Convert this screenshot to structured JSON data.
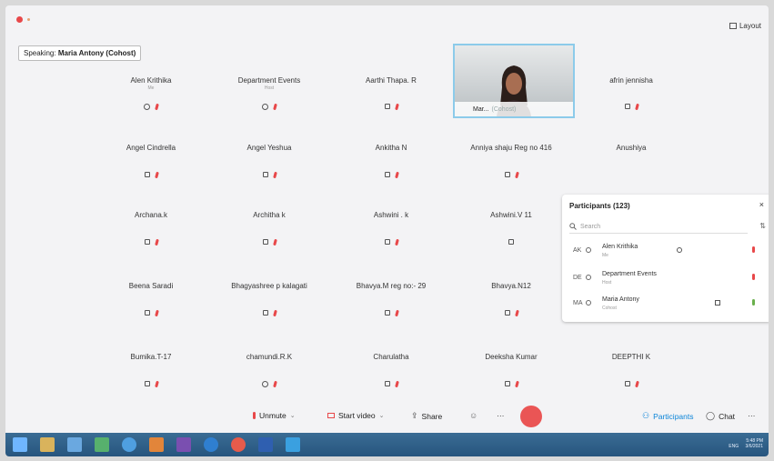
{
  "topbar": {
    "layout_label": "Layout"
  },
  "speaking": {
    "prefix": "Speaking:",
    "name": "Maria Antony (Cohost)"
  },
  "tiles": [
    {
      "name": "Alen Krithika",
      "sub": "Me"
    },
    {
      "name": "Department Events",
      "sub": "Host"
    },
    {
      "name": "Aarthi Thapa. R",
      "sub": ""
    },
    {
      "name": "afrin jennisha",
      "sub": ""
    },
    {
      "name": "Angel Cindrella",
      "sub": ""
    },
    {
      "name": "Angel Yeshua",
      "sub": ""
    },
    {
      "name": "Ankitha N",
      "sub": ""
    },
    {
      "name": "Anniya shaju Reg no 416",
      "sub": ""
    },
    {
      "name": "Anushiya",
      "sub": ""
    },
    {
      "name": "Archana.k",
      "sub": ""
    },
    {
      "name": "Architha k",
      "sub": ""
    },
    {
      "name": "Ashwini . k",
      "sub": ""
    },
    {
      "name": "Ashwini.V 11",
      "sub": ""
    },
    {
      "name": "Beena Saradi",
      "sub": ""
    },
    {
      "name": "Bhagyashree p kalagati",
      "sub": ""
    },
    {
      "name": "Bhavya.M reg no:- 29",
      "sub": ""
    },
    {
      "name": "Bhavya.N12",
      "sub": ""
    },
    {
      "name": "Bumika.T-17",
      "sub": ""
    },
    {
      "name": "chamundi.R.K",
      "sub": ""
    },
    {
      "name": "Charulatha",
      "sub": ""
    },
    {
      "name": "Deeksha Kumar",
      "sub": ""
    },
    {
      "name": "DEEPTHI K",
      "sub": ""
    }
  ],
  "video_tile": {
    "name": "Mar...",
    "role": "(Cohost)"
  },
  "participants": {
    "title": "Participants (123)",
    "close": "×",
    "search_placeholder": "Search",
    "rows": [
      {
        "initials": "AK",
        "name": "Alen Krithika",
        "role": "Me"
      },
      {
        "initials": "DE",
        "name": "Department Events",
        "role": "Host"
      },
      {
        "initials": "MA",
        "name": "Maria Antony",
        "role": "Cohost"
      }
    ]
  },
  "toolbar": {
    "unmute": "Unmute",
    "start_video": "Start video",
    "share": "Share",
    "more": "···",
    "participants": "Participants",
    "chat": "Chat",
    "more_right": "···"
  },
  "taskbar": {
    "time": "5:48 PM",
    "date": "3/6/2021",
    "lang": "ENG"
  },
  "colors": {
    "accent": "#0b84d8",
    "mute_red": "#e8484a",
    "leave_red": "#ea5555",
    "taskbar": "#2d5f88"
  }
}
